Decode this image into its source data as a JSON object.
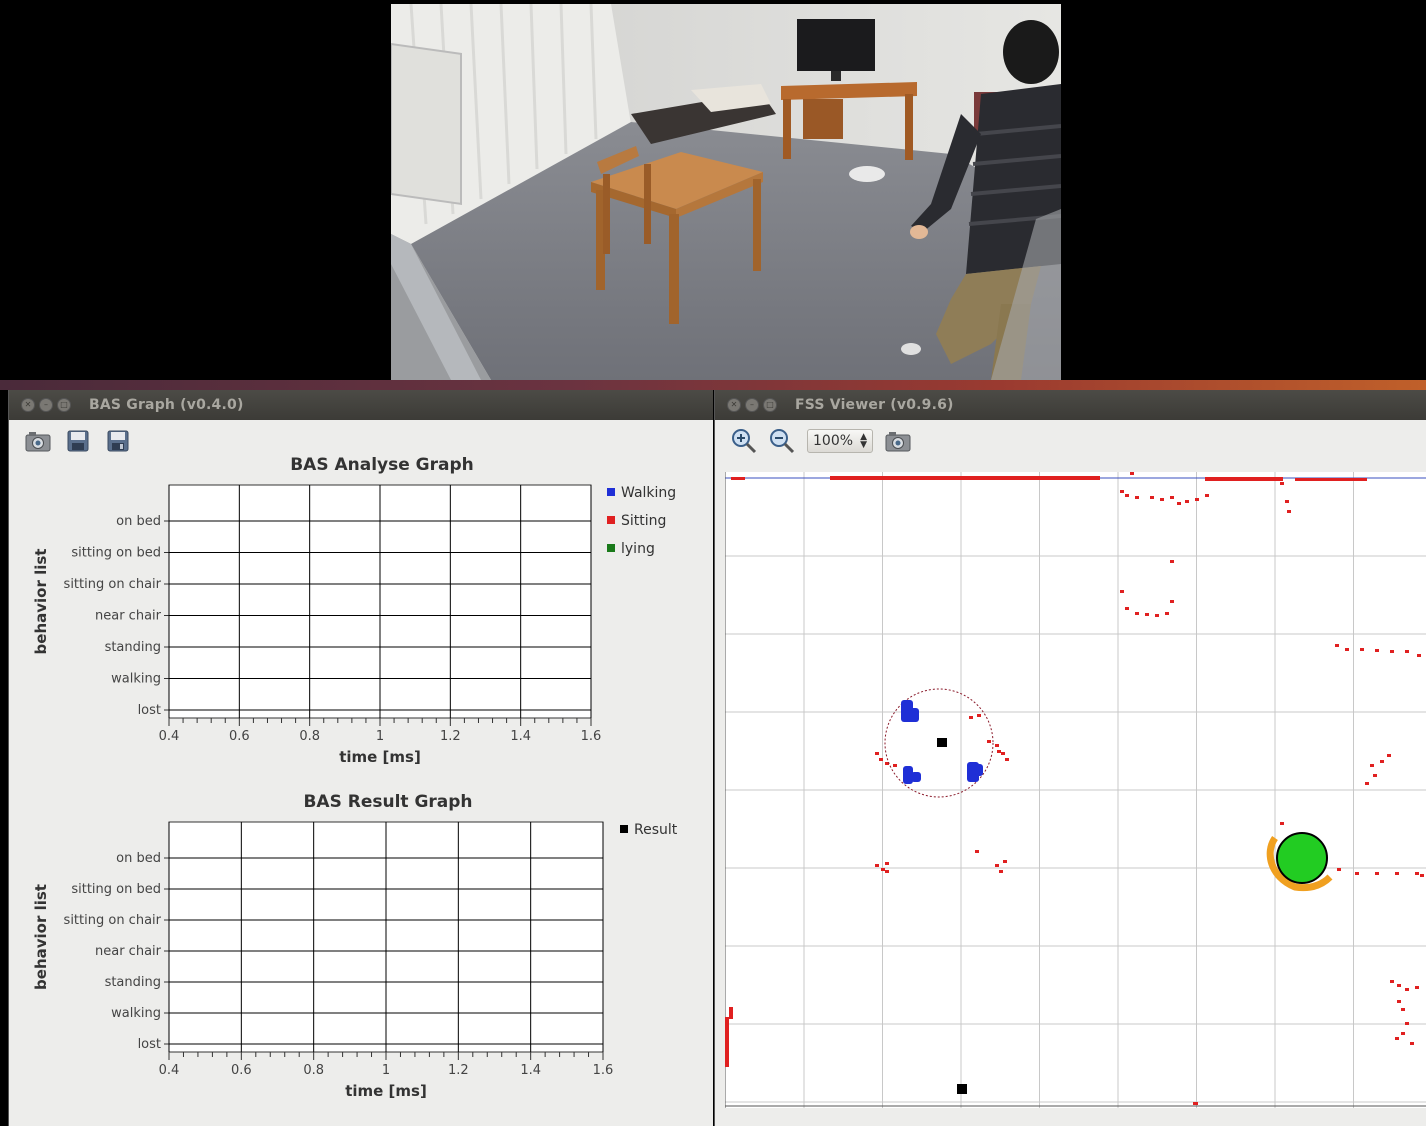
{
  "bas_window": {
    "title": "BAS Graph (v0.4.0)",
    "toolbar": [
      "camera-icon",
      "save-icon",
      "save-as-icon"
    ],
    "analyse_graph": {
      "title": "BAS Analyse Graph",
      "ylabel": "behavior list",
      "xlabel": "time [ms]",
      "categories": [
        "on bed",
        "sitting on bed",
        "sitting on chair",
        "near chair",
        "standing",
        "walking",
        "lost"
      ],
      "xticks": [
        "0.4",
        "0.6",
        "0.8",
        "1",
        "1.2",
        "1.4",
        "1.6"
      ],
      "legend": [
        {
          "label": "Walking",
          "color": "#1f2fd6"
        },
        {
          "label": "Sitting",
          "color": "#e02020"
        },
        {
          "label": "lying",
          "color": "#1a7a1a"
        }
      ]
    },
    "result_graph": {
      "title": "BAS Result Graph",
      "ylabel": "behavior list",
      "xlabel": "time [ms]",
      "categories": [
        "on bed",
        "sitting on bed",
        "sitting on chair",
        "near chair",
        "standing",
        "walking",
        "lost"
      ],
      "xticks": [
        "0.4",
        "0.6",
        "0.8",
        "1",
        "1.2",
        "1.4",
        "1.6"
      ],
      "legend": [
        {
          "label": "Result",
          "color": "#000000"
        }
      ]
    }
  },
  "fss_window": {
    "title": "FSS Viewer (v0.9.6)",
    "zoom": "100%",
    "toolbar": [
      "zoom-in-icon",
      "zoom-out-icon",
      "camera-icon"
    ],
    "colors": {
      "scan_points": "#e02020",
      "person_blobs": "#1f2fd6",
      "robot": "#22cc22",
      "robot_trail": "#f0a020"
    }
  }
}
